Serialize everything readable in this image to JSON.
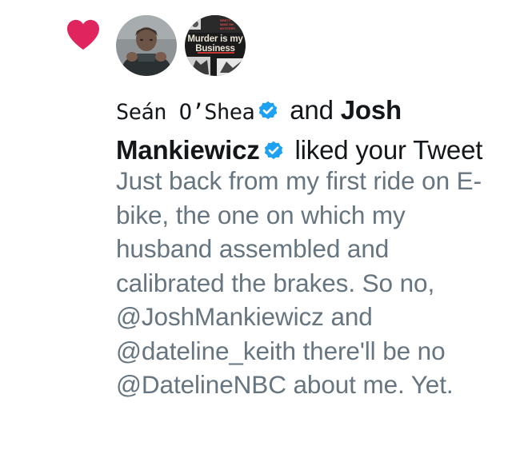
{
  "notification": {
    "type_icon": "heart-icon",
    "accent_color": "#e0245e",
    "verified_color": "#1da1f2",
    "avatars": [
      {
        "icon": "avatar-photo-person"
      },
      {
        "icon": "avatar-book-cover",
        "cover_line_1": "Murder is my",
        "cover_line_2": "Business",
        "cover_small": "BRETT HALLIDAY / MIKE SHAYNE MYSTERY"
      }
    ],
    "user_1": "Seán O’Shea",
    "connector_and": "and",
    "user_2": "Josh Mankiewicz",
    "action_text": "liked your Tweet",
    "tweet_text": "Just back from my first ride on E-bike, the one on which my husband assembled and calibrated the brakes. So no, @JoshMankiewicz and @dateline_keith there'll be no @DatelineNBC about me. Yet."
  }
}
